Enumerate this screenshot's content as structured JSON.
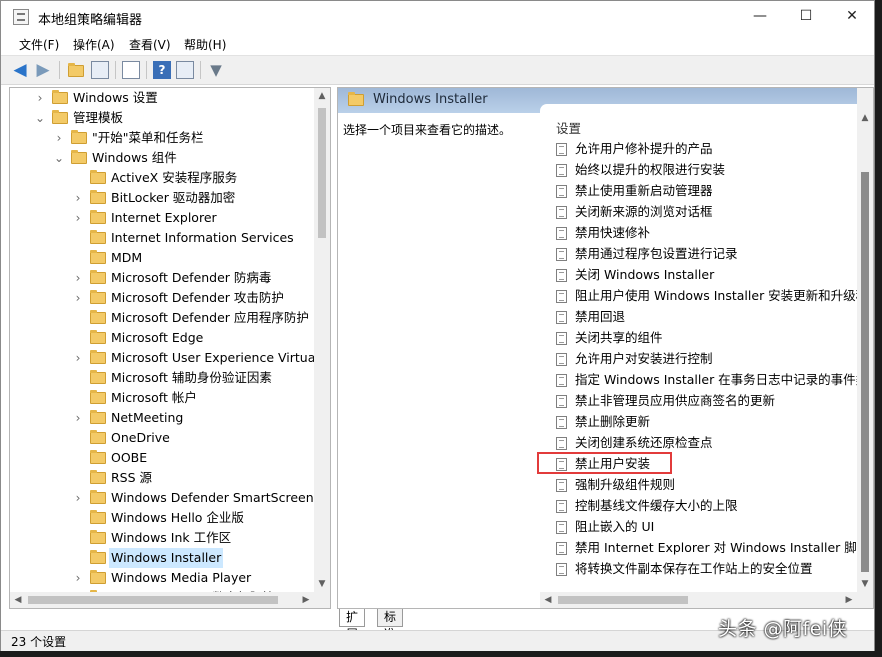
{
  "window": {
    "title": "本地组策略编辑器"
  },
  "menu": [
    "文件(F)",
    "操作(A)",
    "查看(V)",
    "帮助(H)"
  ],
  "toolbar": {
    "help_glyph": "?",
    "icons": [
      "back-arrow-icon",
      "forward-arrow-icon",
      "up-folder-icon",
      "show-hide-tree-icon",
      "export-list-icon",
      "help-icon",
      "properties-icon",
      "filter-icon"
    ]
  },
  "tree": {
    "items": [
      {
        "label": "Windows 设置",
        "level": 1,
        "arrow": "›"
      },
      {
        "label": "管理模板",
        "level": 1,
        "arrow": "⌄"
      },
      {
        "label": "\"开始\"菜单和任务栏",
        "level": 2,
        "arrow": "›"
      },
      {
        "label": "Windows 组件",
        "level": 2,
        "arrow": "⌄"
      },
      {
        "label": "ActiveX 安装程序服务",
        "level": 3,
        "arrow": ""
      },
      {
        "label": "BitLocker 驱动器加密",
        "level": 3,
        "arrow": "›"
      },
      {
        "label": "Internet Explorer",
        "level": 3,
        "arrow": "›"
      },
      {
        "label": "Internet Information Services",
        "level": 3,
        "arrow": ""
      },
      {
        "label": "MDM",
        "level": 3,
        "arrow": ""
      },
      {
        "label": "Microsoft Defender 防病毒",
        "level": 3,
        "arrow": "›"
      },
      {
        "label": "Microsoft Defender 攻击防护",
        "level": 3,
        "arrow": "›"
      },
      {
        "label": "Microsoft Defender 应用程序防护",
        "level": 3,
        "arrow": ""
      },
      {
        "label": "Microsoft Edge",
        "level": 3,
        "arrow": ""
      },
      {
        "label": "Microsoft User Experience Virtualization",
        "level": 3,
        "arrow": "›"
      },
      {
        "label": "Microsoft 辅助身份验证因素",
        "level": 3,
        "arrow": ""
      },
      {
        "label": "Microsoft 帐户",
        "level": 3,
        "arrow": ""
      },
      {
        "label": "NetMeeting",
        "level": 3,
        "arrow": "›"
      },
      {
        "label": "OneDrive",
        "level": 3,
        "arrow": ""
      },
      {
        "label": "OOBE",
        "level": 3,
        "arrow": ""
      },
      {
        "label": "RSS 源",
        "level": 3,
        "arrow": ""
      },
      {
        "label": "Windows Defender SmartScreen",
        "level": 3,
        "arrow": "›"
      },
      {
        "label": "Windows Hello 企业版",
        "level": 3,
        "arrow": ""
      },
      {
        "label": "Windows Ink 工作区",
        "level": 3,
        "arrow": ""
      },
      {
        "label": "Windows Installer",
        "level": 3,
        "arrow": "",
        "selected": true
      },
      {
        "label": "Windows Media Player",
        "level": 3,
        "arrow": "›"
      },
      {
        "label": "Windows Media 数字权限管理",
        "level": 3,
        "arrow": ""
      }
    ]
  },
  "details": {
    "title": "Windows Installer",
    "description": "选择一个项目来查看它的描述。",
    "column_header": "设置",
    "settings": [
      "允许用户修补提升的产品",
      "始终以提升的权限进行安装",
      "禁止使用重新启动管理器",
      "关闭新来源的浏览对话框",
      "禁用快速修补",
      "禁用通过程序包设置进行记录",
      "关闭 Windows Installer",
      "阻止用户使用 Windows Installer 安装更新和升级程序",
      "禁用回退",
      "关闭共享的组件",
      "允许用户对安装进行控制",
      "指定 Windows Installer 在事务日志中记录的事件类型",
      "禁止非管理员应用供应商签名的更新",
      "禁止删除更新",
      "关闭创建系统还原检查点",
      "禁止用户安装",
      "强制升级组件规则",
      "控制基线文件缓存大小的上限",
      "阻止嵌入的 UI",
      "禁用 Internet Explorer 对 Windows Installer 脚本的安全提示",
      "将转换文件副本保存在工作站上的安全位置"
    ],
    "highlighted": "禁止用户安装"
  },
  "tabs": [
    "扩展",
    "标准"
  ],
  "status": "23 个设置",
  "watermark": "头条 @阿fei侠"
}
